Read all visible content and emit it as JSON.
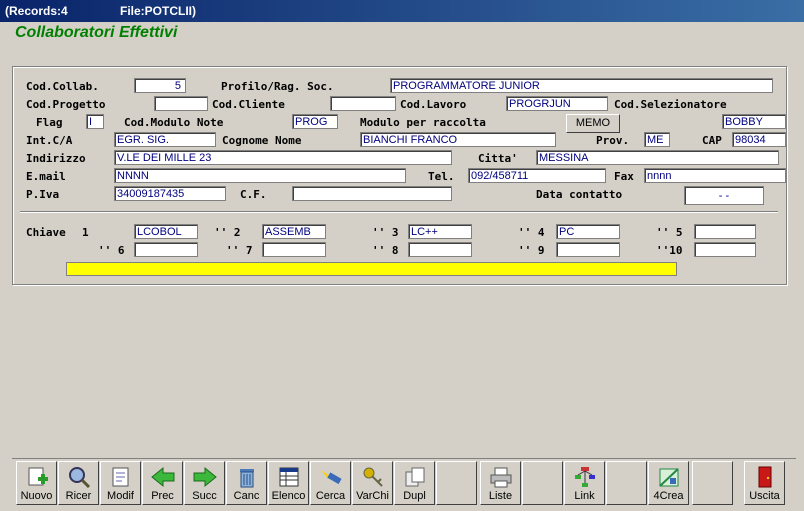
{
  "window": {
    "records": "(Records:4",
    "file": "File:POTCLII)"
  },
  "page_title": "Collaboratori Effettivi",
  "form": {
    "cod_collab": {
      "label": "Cod.Collab.",
      "value": "5"
    },
    "profilo": {
      "label": "Profilo/Rag. Soc.",
      "value": "PROGRAMMATORE JUNIOR"
    },
    "cod_progetto": {
      "label": "Cod.Progetto",
      "value": ""
    },
    "cod_cliente": {
      "label": "Cod.Cliente",
      "value": ""
    },
    "cod_lavoro": {
      "label": "Cod.Lavoro",
      "value": "PROGRJUN"
    },
    "cod_selezionatore": {
      "label": "Cod.Selezionatore",
      "value": "BOBBY"
    },
    "flag": {
      "label": "Flag",
      "value": "I"
    },
    "cod_modulo_note": {
      "label": "Cod.Modulo Note",
      "value": "PROG"
    },
    "modulo_raccolta": {
      "label": "Modulo per raccolta",
      "button": "MEMO"
    },
    "int_ca": {
      "label": "Int.C/A",
      "value": "EGR. SIG."
    },
    "cognome_nome": {
      "label": "Cognome Nome",
      "value": "BIANCHI FRANCO"
    },
    "prov": {
      "label": "Prov.",
      "value": "ME"
    },
    "cap": {
      "label": "CAP",
      "value": "98034"
    },
    "indirizzo": {
      "label": "Indirizzo",
      "value": "V.LE DEI MILLE 23"
    },
    "citta": {
      "label": "Citta'",
      "value": "MESSINA"
    },
    "email": {
      "label": "E.mail",
      "value": "NNNN"
    },
    "tel": {
      "label": "Tel.",
      "value": "092/458711"
    },
    "fax": {
      "label": "Fax",
      "value": "nnnn"
    },
    "piva": {
      "label": "P.Iva",
      "value": "34009187435"
    },
    "cf": {
      "label": "C.F.",
      "value": ""
    },
    "data_contatto": {
      "label": "Data contatto",
      "value": "-   -"
    }
  },
  "keys": {
    "label": "Chiave",
    "items": [
      {
        "label": "1",
        "value": "LCOBOL"
      },
      {
        "label": "'' 2",
        "value": "ASSEMB"
      },
      {
        "label": "'' 3",
        "value": "LC++"
      },
      {
        "label": "'' 4",
        "value": "PC"
      },
      {
        "label": "'' 5",
        "value": ""
      },
      {
        "label": "'' 6",
        "value": ""
      },
      {
        "label": "'' 7",
        "value": ""
      },
      {
        "label": "'' 8",
        "value": ""
      },
      {
        "label": "'' 9",
        "value": ""
      },
      {
        "label": "''10",
        "value": ""
      }
    ]
  },
  "toolbar": {
    "buttons": [
      {
        "label": "Nuovo",
        "icon": "new-document-icon"
      },
      {
        "label": "Ricer",
        "icon": "magnifier-icon"
      },
      {
        "label": "Modif",
        "icon": "edit-document-icon"
      },
      {
        "label": "Prec",
        "icon": "arrow-left-icon"
      },
      {
        "label": "Succ",
        "icon": "arrow-right-icon"
      },
      {
        "label": "Canc",
        "icon": "trash-icon"
      },
      {
        "label": "Elenco",
        "icon": "list-icon"
      },
      {
        "label": "Cerca",
        "icon": "flashlight-icon"
      },
      {
        "label": "VarChi",
        "icon": "keys-icon"
      },
      {
        "label": "Dupl",
        "icon": "duplicate-icon"
      },
      {
        "label": "",
        "icon": ""
      },
      {
        "label": "Liste",
        "icon": "printer-icon"
      },
      {
        "label": "",
        "icon": ""
      },
      {
        "label": "Link",
        "icon": "link-network-icon"
      },
      {
        "label": "",
        "icon": ""
      },
      {
        "label": "4Crea",
        "icon": "build-icon"
      },
      {
        "label": "",
        "icon": ""
      },
      {
        "label": "Uscita",
        "icon": "exit-door-icon"
      }
    ]
  }
}
